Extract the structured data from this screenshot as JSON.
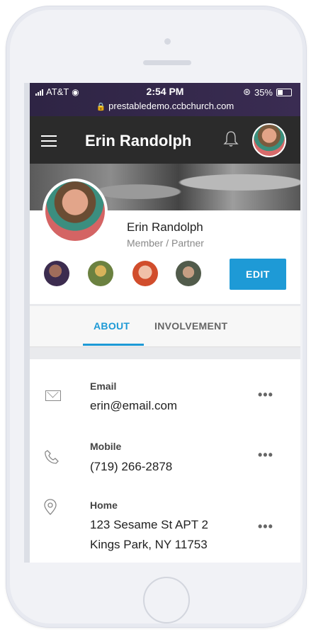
{
  "status_bar": {
    "carrier": "AT&T",
    "time": "2:54 PM",
    "battery": "35%",
    "url": "prestabledemo.ccbchurch.com"
  },
  "app_bar": {
    "title": "Erin Randolph"
  },
  "profile": {
    "name": "Erin Randolph",
    "role": "Member / Partner",
    "edit_label": "EDIT"
  },
  "tabs": {
    "about": "ABOUT",
    "involvement": "INVOLVEMENT"
  },
  "details": {
    "email_label": "Email",
    "email_value": "erin@email.com",
    "mobile_label": "Mobile",
    "mobile_value": "(719) 266-2878",
    "home_label": "Home",
    "home_line1": "123 Sesame St APT 2",
    "home_line2": "Kings Park, NY 11753",
    "more": "•••"
  },
  "icons": {
    "menu": "hamburger-icon",
    "notifications": "bell-icon",
    "email": "envelope-icon",
    "phone": "phone-icon",
    "location": "map-pin-icon"
  }
}
